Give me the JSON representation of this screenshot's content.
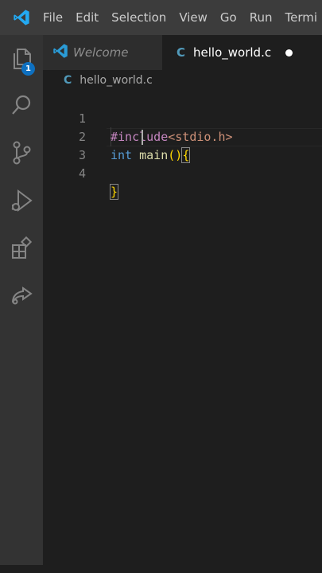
{
  "menu": {
    "items": [
      "File",
      "Edit",
      "Selection",
      "View",
      "Go",
      "Run",
      "Termi"
    ]
  },
  "activity_bar": {
    "explorer_badge": "1",
    "icons": [
      "files-icon",
      "search-icon",
      "source-control-icon",
      "run-debug-icon",
      "extensions-icon",
      "live-share-icon"
    ]
  },
  "tabs": [
    {
      "label": "Welcome",
      "active": false,
      "icon": "vscode-logo-icon"
    },
    {
      "label": "hello_world.c",
      "active": true,
      "icon": "c-file-icon",
      "icon_glyph": "C",
      "dirty": true
    }
  ],
  "breadcrumb": {
    "icon_glyph": "C",
    "file": "hello_world.c"
  },
  "editor": {
    "line_numbers": [
      "1",
      "2",
      "3",
      "4"
    ],
    "line1": {
      "directive": "#include",
      "header": "<stdio.h>"
    },
    "line2": {
      "keyword": "int",
      "space": " ",
      "function": "main",
      "parens": "()",
      "brace": "{"
    },
    "line4": {
      "brace": "}"
    }
  },
  "colors": {
    "accent": "#0e70c0",
    "c_icon": "#519aba",
    "keyword": "#569cd6",
    "function": "#dcdcaa",
    "preprocessor": "#c586c0",
    "string": "#ce9178",
    "bracket": "#ffd700"
  }
}
